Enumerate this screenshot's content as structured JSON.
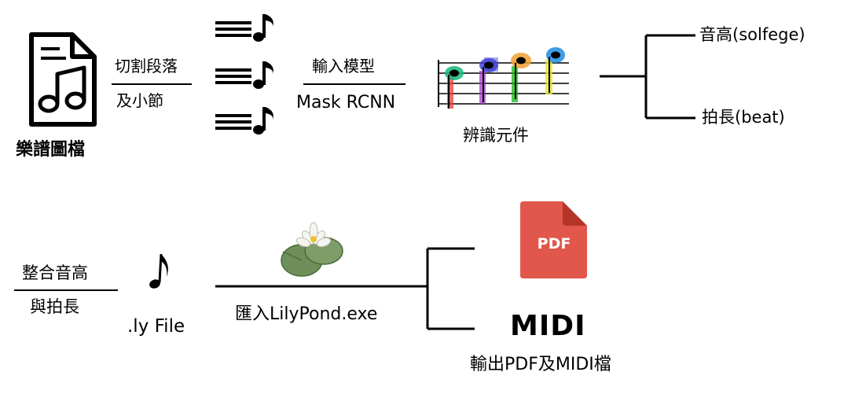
{
  "row1": {
    "score_label": "樂譜圖檔",
    "split_top": "切割段落",
    "split_bottom": "及小節",
    "model_top": "輸入模型",
    "model_bottom": "Mask RCNN",
    "recognize_label": "辨識元件",
    "pitch_label": "音高(solfege)",
    "beat_label": "拍長(beat)"
  },
  "row2": {
    "merge_top": "整合音高",
    "merge_bottom": "與拍長",
    "ly_file_label": ".ly File",
    "lilypond_label": "匯入LilyPond.exe",
    "pdf_badge": "PDF",
    "midi_logo": "MIDI",
    "output_label": "輸出PDF及MIDI檔"
  },
  "colors": {
    "pdf_red": "#e2574c",
    "note_green": "#14b97c",
    "note_purple": "#a03cc8",
    "note_orange": "#f0a030",
    "note_blue": "#1e8ce0"
  }
}
